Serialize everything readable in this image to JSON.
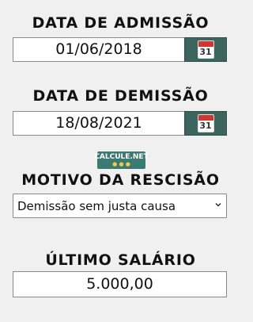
{
  "admission": {
    "title": "DATA DE ADMISSÃO",
    "value": "01/06/2018",
    "calendar_day": "31"
  },
  "dismissal": {
    "title": "DATA DE DEMISSÃO",
    "value": "18/08/2021",
    "calendar_day": "31"
  },
  "logo": {
    "text": "CALCULE.NET"
  },
  "reason": {
    "title": "MOTIVO DA RESCISÃO",
    "selected": "Demissão sem justa causa"
  },
  "salary": {
    "title": "ÚLTIMO SALÁRIO",
    "value": "5.000,00"
  },
  "colors": {
    "background": "#f0f0f0",
    "calendar_button": "#3c6560",
    "logo_bg": "#3a7a72",
    "calendar_red": "#d9322b"
  }
}
